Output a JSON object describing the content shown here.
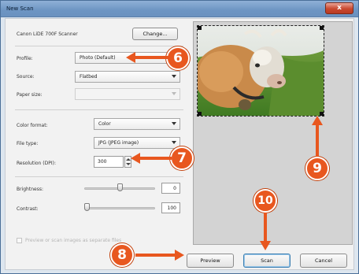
{
  "window": {
    "title": "New Scan",
    "close_glyph": "x"
  },
  "scanner": {
    "name": "Canon LiDE 700F Scanner",
    "change_label": "Change..."
  },
  "profile": {
    "label": "Profile:",
    "value": "Photo (Default)"
  },
  "source": {
    "label": "Source:",
    "value": "Flatbed"
  },
  "paper_size": {
    "label": "Paper size:",
    "value": ""
  },
  "color_format": {
    "label": "Color format:",
    "value": "Color"
  },
  "file_type": {
    "label": "File type:",
    "value": "JPG (JPEG image)"
  },
  "resolution": {
    "label": "Resolution (DPI):",
    "value": "300"
  },
  "brightness": {
    "label": "Brightness:",
    "value": "0",
    "level": 0.5
  },
  "contrast": {
    "label": "Contrast:",
    "value": "100",
    "level": 0.0
  },
  "options": {
    "preview_separate_label": "Preview or scan images as separate files"
  },
  "buttons": {
    "preview": "Preview",
    "scan": "Scan",
    "cancel": "Cancel"
  },
  "callouts": {
    "six": "6",
    "seven": "7",
    "eight": "8",
    "nine": "9",
    "ten": "10"
  },
  "colors": {
    "callout": "#e8571f",
    "title_bar": "#7aa0cc"
  }
}
